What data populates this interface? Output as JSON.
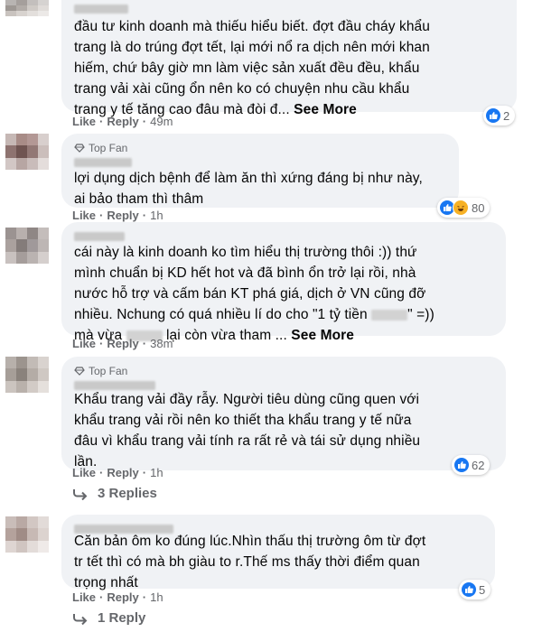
{
  "colors": {
    "accent": "#1877f2",
    "bubble": "#f0f2f5",
    "meta": "#65676b"
  },
  "comments": [
    {
      "top_fan": "",
      "text": "đầu tư kinh doanh mà thiếu hiểu biết. đợt đầu cháy khẩu\ntrang là do trúng đợt tết, lại mới nổ ra dịch nên mới khan\nhiếm, chứ bây giờ mn làm việc sản xuất đều đều, khẩu\ntrang vải xài cũng ổn nên ko có chuyện nhu cầu khẩu\ntrang y tế tăng cao đâu mà đòi đ...",
      "see_more": "See More",
      "like": "Like",
      "reply": "Reply",
      "time": "49m",
      "reaction_count": "2"
    },
    {
      "top_fan": "Top Fan",
      "text": "lợi dụng dịch bệnh để làm ăn thì xứng đáng bị như này,\nai bảo tham thì thâm",
      "see_more": "",
      "like": "Like",
      "reply": "Reply",
      "time": "1h",
      "reaction_count": "80"
    },
    {
      "top_fan": "",
      "text_part1": "cái này là kinh doanh ko tìm hiểu thị trường thôi :)) thứ\nmình chuẩn bị KD hết hot và đã bình ổn trở lại rồi, nhà\nnước hỗ trợ và cấm bán KT phá giá, dịch ở VN cũng đỡ\nnhiều. Nchung có quá nhiều lí do cho \"1 tỷ tiền ",
      "text_part2": "\" =))\nmà vừa ",
      "text_part3": " lại còn vừa tham ...",
      "see_more": "See More",
      "like": "Like",
      "reply": "Reply",
      "time": "38m",
      "reaction_count": ""
    },
    {
      "top_fan": "Top Fan",
      "text": "Khẩu trang vải đầy rẫy. Người tiêu dùng cũng quen với\nkhẩu trang vải rồi nên ko thiết tha khẩu trang y tế nữa\nđâu vì khẩu trang vải tính ra rất rẻ và tái sử dụng nhiều\nlần.",
      "see_more": "",
      "like": "Like",
      "reply": "Reply",
      "time": "1h",
      "reaction_count": "62",
      "replies_label": "3 Replies"
    },
    {
      "top_fan": "",
      "text": "Căn bản ôm ko đúng lúc.Nhìn thấu thị trường ôm từ đợt\ntr tết thì có mà bh giàu to r.Thế ms thấy thời điểm quan\ntrọng nhất",
      "see_more": "",
      "like": "Like",
      "reply": "Reply",
      "time": "1h",
      "reaction_count": "5",
      "replies_label": "1 Reply"
    }
  ]
}
